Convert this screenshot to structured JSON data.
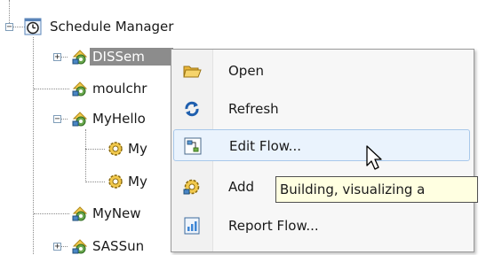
{
  "tree": {
    "root": {
      "label": "Schedule Manager",
      "icon": "clock-icon"
    },
    "items": [
      {
        "label": "DISSem",
        "icon": "flow-gear-icon",
        "selected": true
      },
      {
        "label": "moulchr",
        "icon": "flow-gear-icon"
      },
      {
        "label": "MyHello",
        "icon": "flow-gear-icon"
      },
      {
        "label": "My",
        "icon": "gear-icon"
      },
      {
        "label": "My",
        "icon": "gear-icon"
      },
      {
        "label": "MyNew",
        "icon": "flow-gear-icon"
      },
      {
        "label": "SASSun",
        "icon": "flow-gear-icon"
      }
    ]
  },
  "context_menu": {
    "items": [
      {
        "label": "Open",
        "icon": "folder-open-icon"
      },
      {
        "label": "Refresh",
        "icon": "refresh-icon"
      },
      {
        "label": "Edit Flow...",
        "icon": "flow-diagram-icon",
        "hovered": true
      },
      {
        "label": "Add",
        "icon": "gear-add-icon"
      },
      {
        "label": "Report Flow...",
        "icon": "report-icon"
      }
    ]
  },
  "tooltip": {
    "text": "Building, visualizing a"
  },
  "colors": {
    "selection": "#8c8c8c",
    "hover": "#eaf3fd",
    "tooltip_bg": "#ffffe1"
  }
}
